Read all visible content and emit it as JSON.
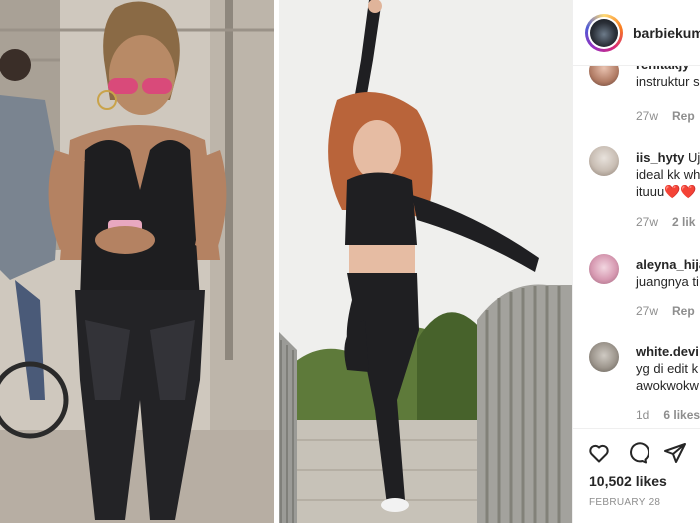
{
  "post": {
    "username": "barbiekum",
    "likes": "10,502 likes",
    "date": "FEBRUARY 28"
  },
  "comments": [
    {
      "user": "renitakjy",
      "text": "",
      "line2": "instruktur s",
      "time": "27w",
      "likes": "Rep"
    },
    {
      "user": "iis_hyty",
      "text": "Uj",
      "line2": "ideal kk wh",
      "line3": "ituuu❤️❤️",
      "time": "27w",
      "likes": "2 lik"
    },
    {
      "user": "aleyna_hija",
      "text": "",
      "line2": "juangnya ti",
      "time": "27w",
      "likes": "Rep"
    },
    {
      "user": "white.devi",
      "text": "",
      "line2": "yg di edit k",
      "line3": "awokwokw",
      "time": "1d",
      "likes": "6 likes"
    }
  ],
  "icons": {
    "like": "heart-icon",
    "comment": "comment-icon",
    "share": "share-icon"
  },
  "colors": {
    "text": "#262626",
    "meta": "#8e8e8e",
    "border": "#efefef"
  }
}
